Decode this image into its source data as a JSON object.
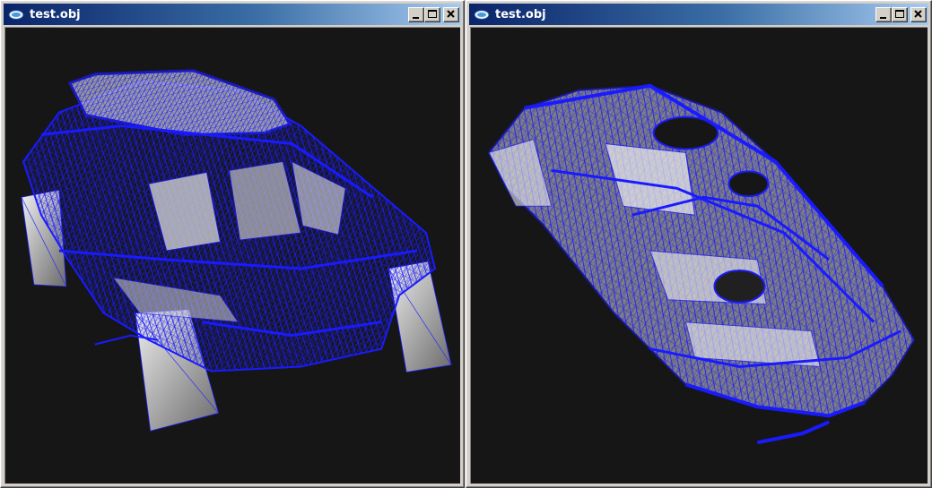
{
  "windows": [
    {
      "title": "test.obj",
      "controls": [
        "minimize",
        "maximize",
        "close"
      ],
      "content": "3D render of car model wireframe (front view)"
    },
    {
      "title": "test.obj",
      "controls": [
        "minimize",
        "maximize",
        "close"
      ],
      "content": "3D render of car model wireframe (top-down view)"
    }
  ],
  "colors": {
    "viewport_bg": "#161616",
    "wireframe": "#1a1aff",
    "surface": "#c8c8c8",
    "titlebar_start": "#0a246a",
    "titlebar_end": "#a6caf0"
  }
}
